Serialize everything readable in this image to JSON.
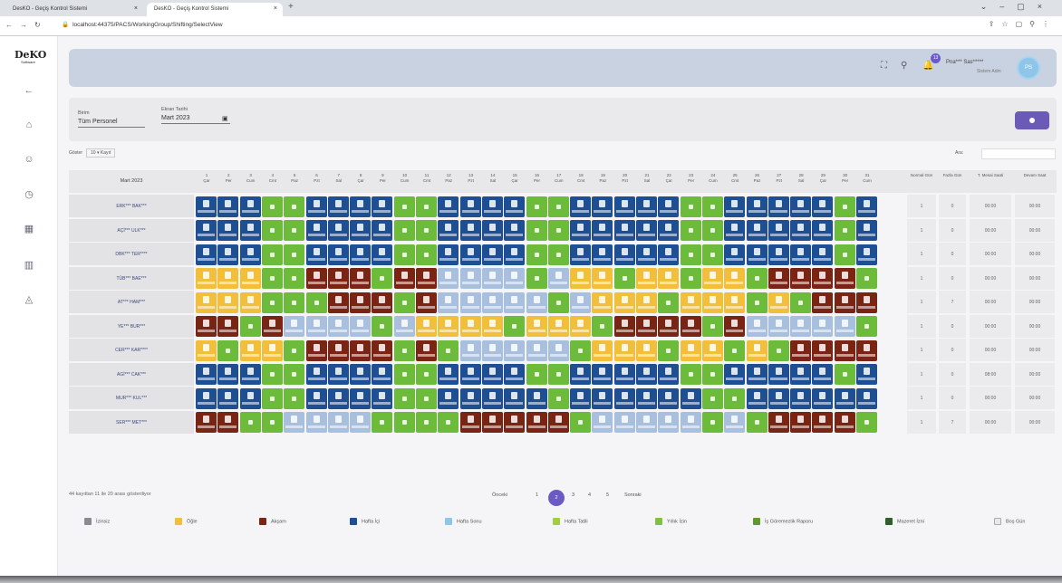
{
  "browser": {
    "tabs": [
      "DesKO - Geçiş Kontrol Sistemi",
      "DesKO - Geçiş Kontrol Sistemi"
    ],
    "url": "localhost:44375/PACS/WorkingGroup/Shifting/SelectView"
  },
  "logo": {
    "text": "DeKO",
    "subtitle": "Software"
  },
  "header": {
    "user_name": "Pna*** Sas*****",
    "user_role": "Sistem Adm",
    "notif_count": "13",
    "avatar_initials": "PS"
  },
  "filter": {
    "birim_label": "Birim",
    "birim_value": "Tüm Personel",
    "date_label": "Ekran Tarihi",
    "date_value": "Mart 2023"
  },
  "grid_top": {
    "show_label": "Göster",
    "show_value": "10 ▾ Kayıt",
    "search_label": "Ara:"
  },
  "grid": {
    "month_label": "Mart 2023",
    "days": [
      [
        "1",
        "Çar"
      ],
      [
        "2",
        "Per"
      ],
      [
        "3",
        "Cum"
      ],
      [
        "4",
        "Cmt"
      ],
      [
        "5",
        "Paz"
      ],
      [
        "6",
        "Pzt"
      ],
      [
        "7",
        "Sal"
      ],
      [
        "8",
        "Çar"
      ],
      [
        "9",
        "Per"
      ],
      [
        "10",
        "Cum"
      ],
      [
        "11",
        "Cmt"
      ],
      [
        "12",
        "Paz"
      ],
      [
        "13",
        "Pzt"
      ],
      [
        "14",
        "Sal"
      ],
      [
        "15",
        "Çar"
      ],
      [
        "16",
        "Per"
      ],
      [
        "17",
        "Cum"
      ],
      [
        "18",
        "Cmt"
      ],
      [
        "19",
        "Paz"
      ],
      [
        "20",
        "Pzt"
      ],
      [
        "21",
        "Sal"
      ],
      [
        "22",
        "Çar"
      ],
      [
        "23",
        "Per"
      ],
      [
        "24",
        "Cum"
      ],
      [
        "25",
        "Cmt"
      ],
      [
        "26",
        "Paz"
      ],
      [
        "27",
        "Pzt"
      ],
      [
        "28",
        "Sal"
      ],
      [
        "29",
        "Çar"
      ],
      [
        "30",
        "Per"
      ],
      [
        "31",
        "Cum"
      ]
    ],
    "summary_headers": [
      "Normal Gün",
      "Fazla Gün",
      "T. Mesai Saati",
      "Devam Saat"
    ],
    "rows": [
      {
        "name": "ERK*** BAK***",
        "cells": "BBBGGBBBBGGBBBBGGBBBBBGGBBBBBGB",
        "summary": [
          "1",
          "0",
          "00:00",
          "00:00"
        ]
      },
      {
        "name": "AÇİ*** ULK***",
        "cells": "BBBGGBBBBGGBBBBGGBBBBBGGBBBBBGB",
        "summary": [
          "1",
          "0",
          "00:00",
          "00:00"
        ]
      },
      {
        "name": "DBK*** TER****",
        "cells": "BBBGGBBBBGGBBBBGGBBBBBGGBBBBBGB",
        "summary": [
          "1",
          "0",
          "00:00",
          "00:00"
        ]
      },
      {
        "name": "TÜB*** BAE***",
        "cells": "YYYGGRRRGRRLLLLGLYYGYYGYYGRRRRG",
        "summary": [
          "1",
          "0",
          "00:00",
          "00:00"
        ]
      },
      {
        "name": "AT*** HAM***",
        "cells": "YYYGGGRRRGRLLLLLGLYYYGYYYGYGRRR",
        "summary": [
          "1",
          "7",
          "00:00",
          "00:00"
        ]
      },
      {
        "name": "YE*** BUR***",
        "cells": "RRGRLLLLGLYYYYGYYYGRRRRGRLLLLLG",
        "summary": [
          "1",
          "0",
          "00:00",
          "00:00"
        ]
      },
      {
        "name": "CER*** KAR****",
        "cells": "YGYYGRRRRGRGLLLLLGYYYGYYGYGRRRR",
        "summary": [
          "1",
          "0",
          "00:00",
          "00:00"
        ]
      },
      {
        "name": "AGİ*** CAK***",
        "cells": "BBBGGBBBBGGBBBBGGBBBBBGGBBBBBGB",
        "summary": [
          "1",
          "0",
          "08:00",
          "00:00"
        ]
      },
      {
        "name": "MUR*** KUL***",
        "cells": "BBBGGBBBBGGBBBBBGBBBBBBGGBBBBBB",
        "summary": [
          "1",
          "0",
          "00:00",
          "00:00"
        ]
      },
      {
        "name": "SER*** MET***",
        "cells": "RRGGLLLLGGGGRRRRRGLLLLLGLGRRRRG",
        "summary": [
          "1",
          "7",
          "00:00",
          "00:00"
        ]
      }
    ]
  },
  "footer": {
    "info": "44 kayıttan 11 ile 20 arası gösteriliyor",
    "prev": "Önceki",
    "pages": [
      "1",
      "2",
      "3",
      "4",
      "5"
    ],
    "active_page": "2",
    "next": "Sonraki"
  },
  "legend": [
    {
      "label": "İzinsiz",
      "color": "#8a8a92"
    },
    {
      "label": "Öğle",
      "color": "#f2bf3a"
    },
    {
      "label": "Akşam",
      "color": "#7a2414"
    },
    {
      "label": "Hafta İçi",
      "color": "#1f4f93"
    },
    {
      "label": "Hafta Sonu",
      "color": "#8ec6ea"
    },
    {
      "label": "Hafta Tatili",
      "color": "#9fcf40"
    },
    {
      "label": "Yıllık İzin",
      "color": "#7fc243"
    },
    {
      "label": "İş Göremezlik Raporu",
      "color": "#5e9a30"
    },
    {
      "label": "Mazeret İzni",
      "color": "#2f5f28"
    },
    {
      "label": "Boş Gün",
      "color": "#e8e8ea"
    }
  ]
}
